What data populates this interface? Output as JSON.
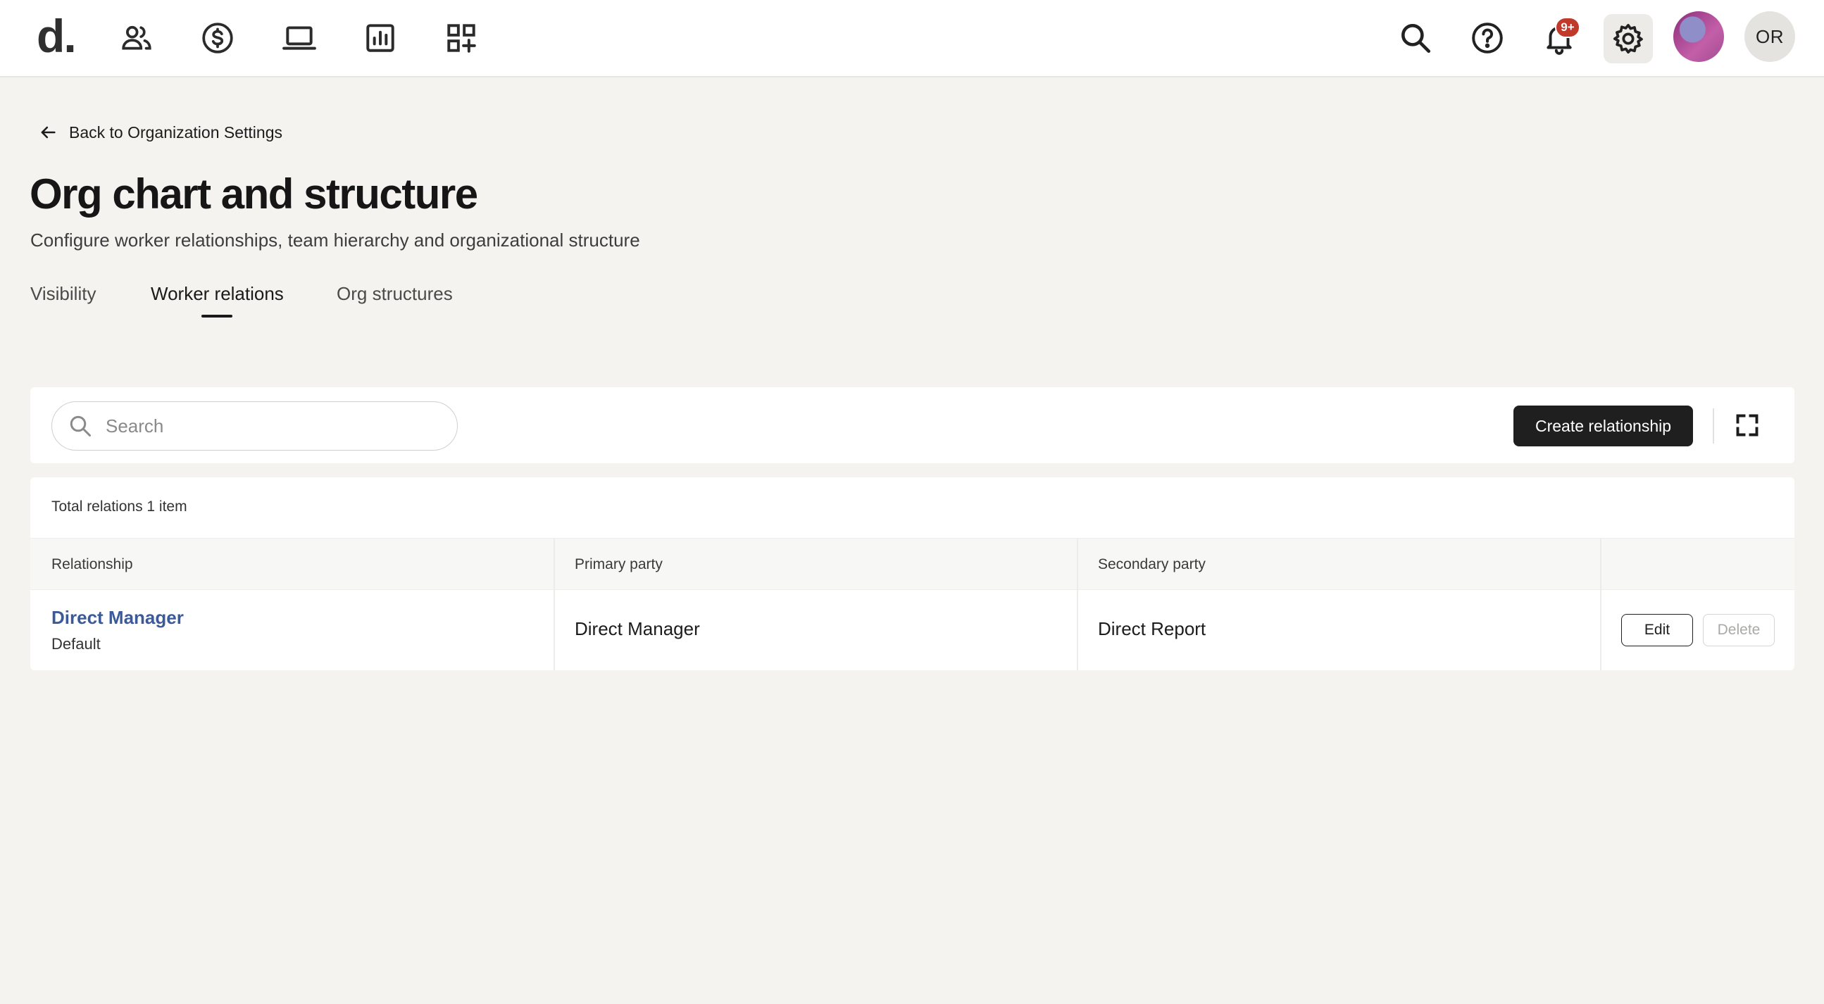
{
  "app": {
    "logo_text": "d.",
    "nav_icons": [
      "people-icon",
      "dollar-icon",
      "laptop-icon",
      "bar-chart-icon",
      "apps-add-icon"
    ],
    "right_icons": [
      "search-icon",
      "help-icon",
      "bell-icon",
      "gear-icon"
    ],
    "notification_badge": "9+",
    "user_initials": "OR",
    "colors": {
      "accent_link": "#3b5a9a",
      "primary_button": "#1f1f1f",
      "badge": "#c0392b",
      "page_bg": "#f4f3f0"
    }
  },
  "header": {
    "back_label": "Back to Organization Settings",
    "title": "Org chart and structure",
    "subtitle": "Configure worker relationships, team hierarchy and organizational structure"
  },
  "tabs": [
    {
      "label": "Visibility",
      "active": false
    },
    {
      "label": "Worker relations",
      "active": true
    },
    {
      "label": "Org structures",
      "active": false
    }
  ],
  "toolbar": {
    "search_placeholder": "Search",
    "search_value": "",
    "create_label": "Create relationship"
  },
  "table": {
    "total_label": "Total relations 1 item",
    "columns": [
      "Relationship",
      "Primary party",
      "Secondary party"
    ],
    "rows": [
      {
        "relationship": "Direct Manager",
        "relationship_sub": "Default",
        "primary": "Direct Manager",
        "secondary": "Direct Report",
        "edit_label": "Edit",
        "delete_label": "Delete"
      }
    ]
  }
}
